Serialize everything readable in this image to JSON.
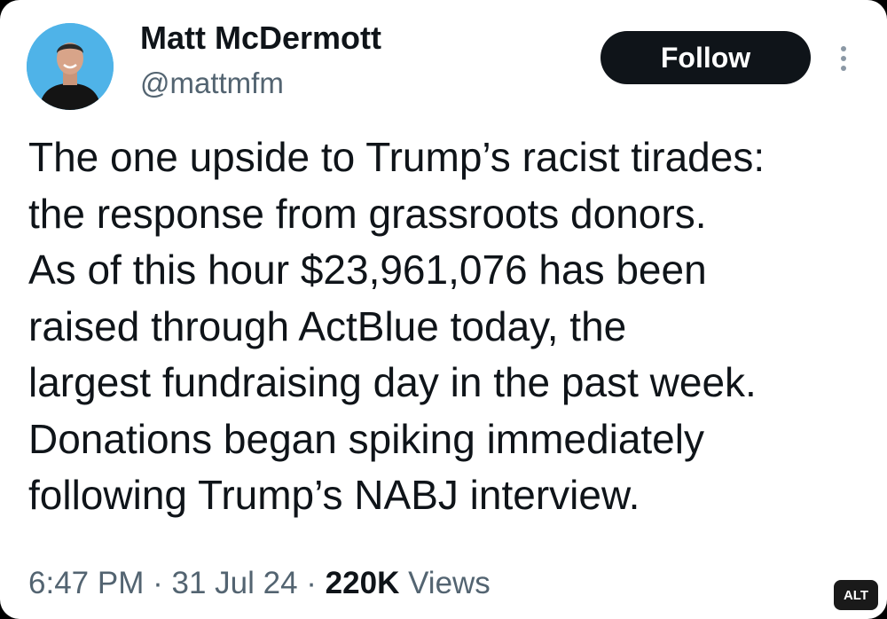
{
  "tweet": {
    "author": {
      "display_name": "Matt McDermott",
      "handle": "@mattmfm",
      "avatar_bg": "#4fb3e8"
    },
    "follow_label": "Follow",
    "more_icon": "more-vertical-icon",
    "text_lines": [
      "The one upside to Trump’s racist tirades:",
      "the response from grassroots donors.",
      "As of this hour $23,961,076 has been",
      "raised through ActBlue today, the",
      "largest fundraising day in the past week.",
      "Donations began spiking immediately",
      "following Trump’s NABJ interview."
    ],
    "time": "6:47 PM",
    "separator": "·",
    "date": "31 Jul 24",
    "views_count": "220K",
    "views_label": "Views"
  },
  "alt_badge": "ALT",
  "colors": {
    "text_primary": "#0f1419",
    "text_secondary": "#536471",
    "button_bg": "#0f1419"
  }
}
